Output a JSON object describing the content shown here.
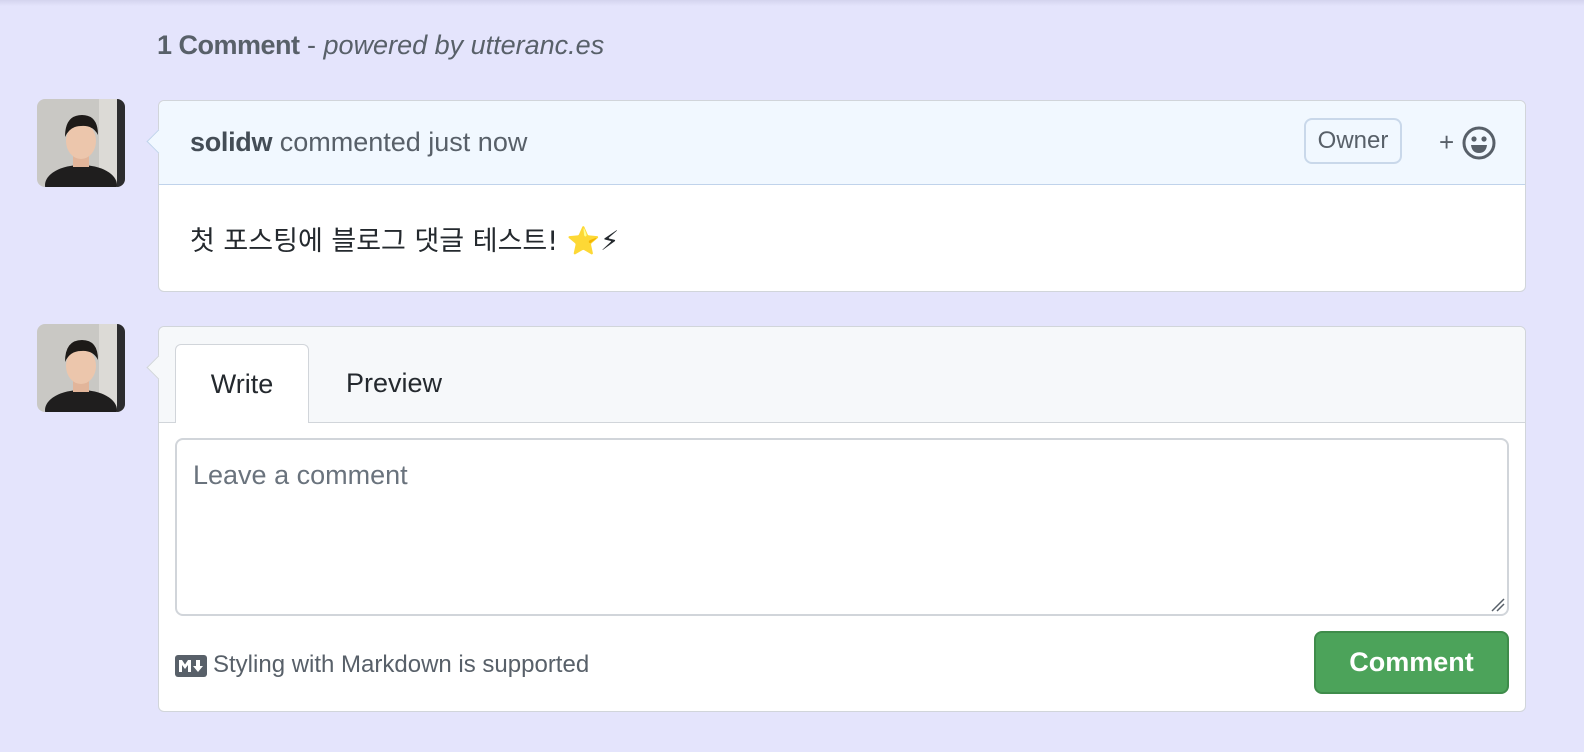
{
  "header": {
    "count_label": "1 Comment",
    "separator": " - ",
    "powered_label": "powered by utteranc.es"
  },
  "comment": {
    "author": "solidw",
    "action_text": " commented just now",
    "badge": "Owner",
    "add_reaction_symbol": "+",
    "body": "첫 포스팅에 블로그 댓글 테스트! ⭐⚡"
  },
  "form": {
    "tabs": [
      {
        "label": "Write",
        "active": true
      },
      {
        "label": "Preview",
        "active": false
      }
    ],
    "placeholder": "Leave a comment",
    "value": "",
    "markdown_note": "Styling with Markdown is supported",
    "submit_label": "Comment"
  },
  "icons": {
    "reaction": "smiley-icon",
    "markdown": "markdown-icon",
    "avatar": "user-avatar"
  },
  "colors": {
    "page_background": "#e4e4fc",
    "comment_header_background": "#f1f8ff",
    "submit_button": "#4ca35a",
    "text_muted": "#586069"
  }
}
